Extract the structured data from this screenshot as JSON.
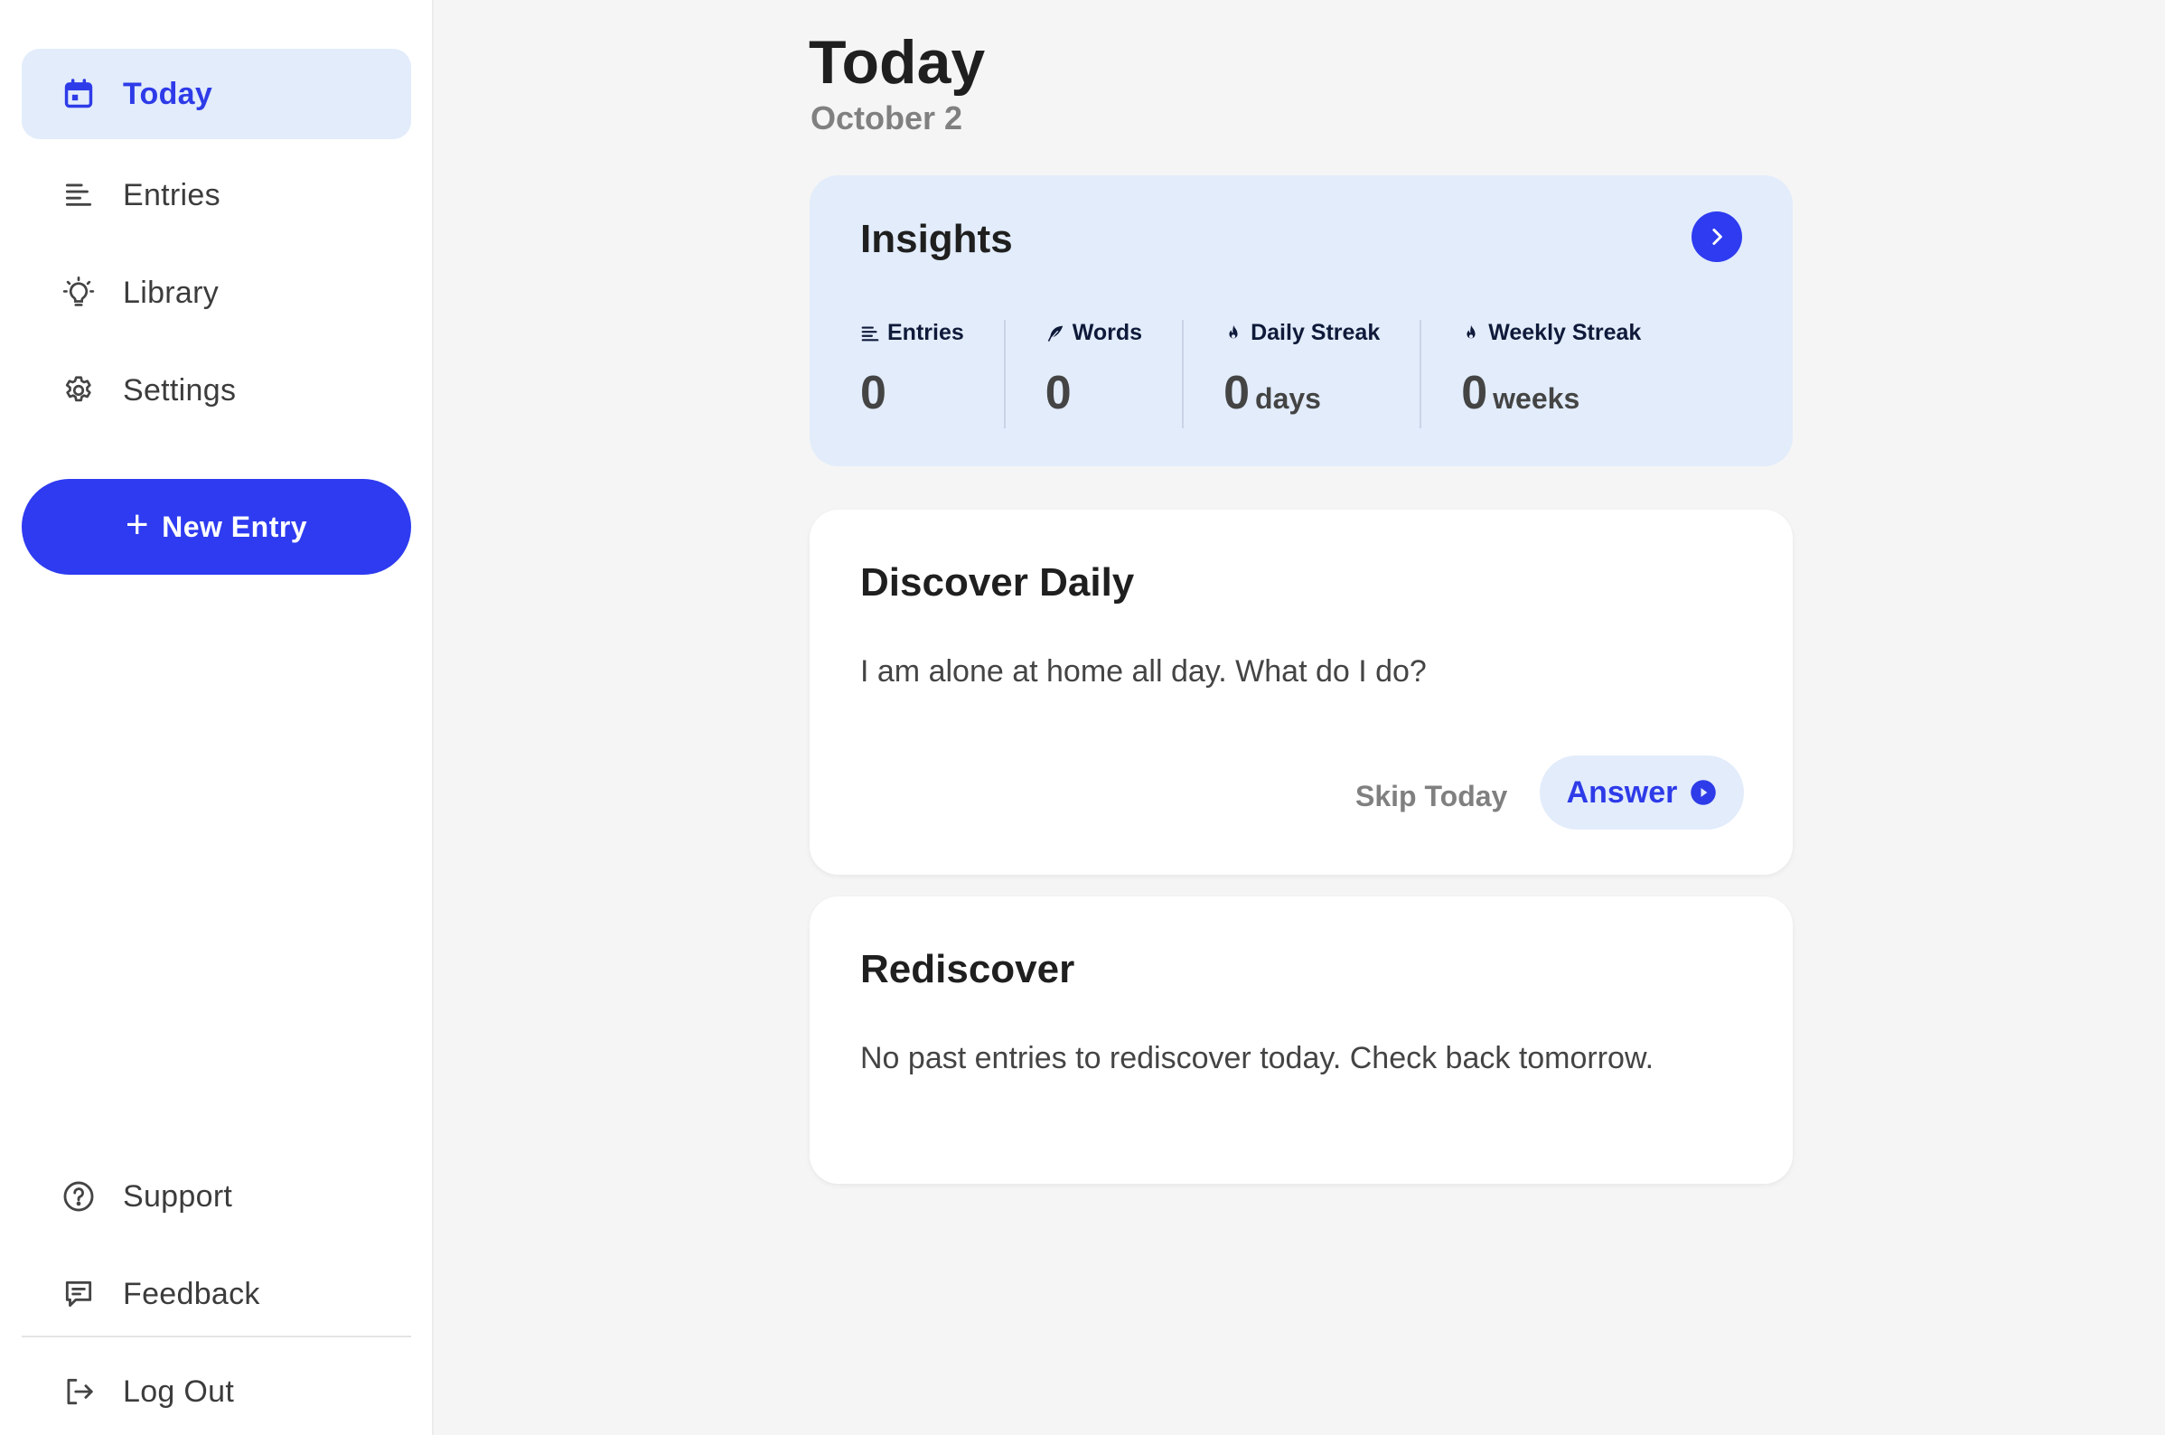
{
  "sidebar": {
    "nav": [
      {
        "label": "Today",
        "icon": "calendar-icon",
        "active": true
      },
      {
        "label": "Entries",
        "icon": "list-icon"
      },
      {
        "label": "Library",
        "icon": "lightbulb-icon"
      },
      {
        "label": "Settings",
        "icon": "gear-icon"
      }
    ],
    "new_entry_label": "New Entry",
    "bottom": [
      {
        "label": "Support",
        "icon": "help-circle-icon"
      },
      {
        "label": "Feedback",
        "icon": "message-icon"
      },
      {
        "label": "Log Out",
        "icon": "logout-icon"
      }
    ]
  },
  "header": {
    "title": "Today",
    "date": "October 2"
  },
  "insights": {
    "title": "Insights",
    "stats": [
      {
        "label": "Entries",
        "value": "0",
        "unit": "",
        "icon": "list-icon"
      },
      {
        "label": "Words",
        "value": "0",
        "unit": "",
        "icon": "feather-icon"
      },
      {
        "label": "Daily Streak",
        "value": "0",
        "unit": "days",
        "icon": "flame-icon"
      },
      {
        "label": "Weekly Streak",
        "value": "0",
        "unit": "weeks",
        "icon": "flame-icon"
      }
    ]
  },
  "discover": {
    "title": "Discover Daily",
    "prompt": "I am alone at home all day. What do I do?",
    "skip_label": "Skip Today",
    "answer_label": "Answer"
  },
  "rediscover": {
    "title": "Rediscover",
    "message": "No past entries to rediscover today. Check back tomorrow."
  },
  "colors": {
    "accent": "#2e3bf0",
    "accent_light": "#e2ecfb",
    "background": "#f5f5f5"
  }
}
